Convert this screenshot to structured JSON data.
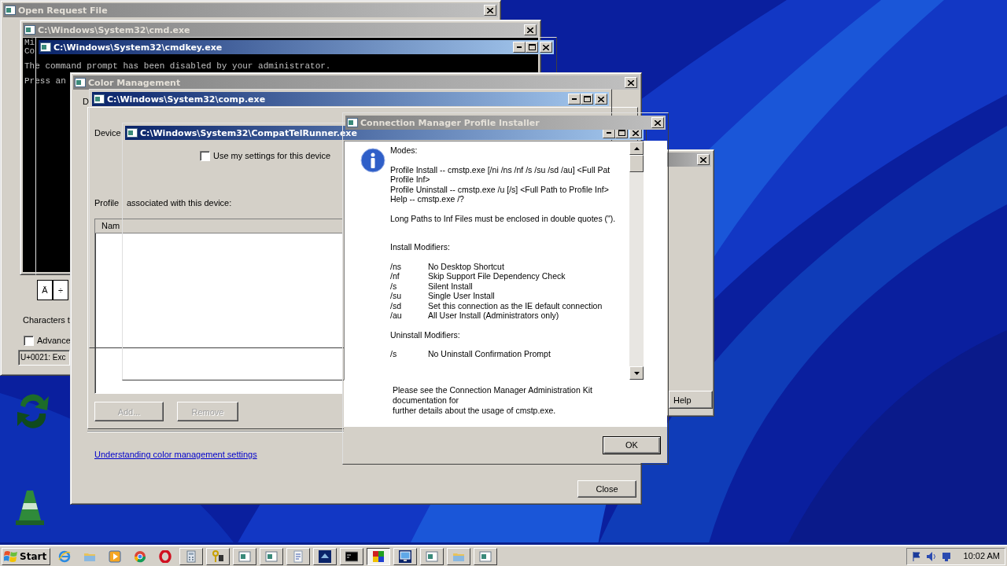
{
  "windows": [
    {
      "kind": "charmap",
      "title": "Open Request File",
      "active": false,
      "can_minimize": false,
      "grid": [
        "Ä",
        "÷"
      ],
      "caption": "Characters t",
      "advanced": {
        "label": "Advance",
        "checked": false
      },
      "code_field": "U+0021: Exc"
    },
    {
      "kind": "console",
      "title": "C:\\Windows\\System32\\cmd.exe",
      "active": false,
      "can_minimize": false,
      "lines": [
        "Mi",
        "Co",
        "The command prompt has been disabled by your administrator.",
        "Press an"
      ]
    },
    {
      "kind": "ghost",
      "title": "C:\\Windows\\System32\\cmdkey.exe",
      "active": true,
      "can_minimize": true
    },
    {
      "kind": "color",
      "title": "Color Management",
      "active": false,
      "can_minimize": false,
      "tab": "D",
      "device_label": "Device",
      "use_my_settings": {
        "label": "Use my settings for this device",
        "checked": false
      },
      "profiles_label": [
        "Profile",
        "associated with this device:"
      ],
      "column": "Nam",
      "buttons": [
        {
          "label": "Add...",
          "disabled": true
        },
        {
          "label": "Remove",
          "disabled": true
        }
      ],
      "link": "Understanding color management settings",
      "close_button": "Close"
    },
    {
      "kind": "ghost",
      "title": "C:\\Windows\\System32\\comp.exe",
      "active": true,
      "can_minimize": true
    },
    {
      "kind": "ghost",
      "title": "C:\\Windows\\System32\\CompatTelRunner.exe",
      "active": true,
      "can_minimize": true
    },
    {
      "kind": "back",
      "active": false,
      "can_minimize": false,
      "help_button": "Help"
    },
    {
      "kind": "message",
      "title": "Connection Manager Profile Installer",
      "active": false,
      "can_minimize": false,
      "paragraphs": [
        {
          "kind": "text",
          "lines": [
            "Modes:"
          ]
        },
        {
          "kind": "text",
          "lines": [
            "Profile Install -- cmstp.exe [/ni /ns /nf /s /su /sd /au] <Full Pat",
            "Profile Inf>",
            "Profile Uninstall -- cmstp.exe /u [/s] <Full Path to Profile Inf>",
            "Help -- cmstp.exe /?"
          ]
        },
        {
          "kind": "text",
          "lines": [
            "Long Paths to Inf Files must be enclosed in double quotes (\")."
          ]
        },
        {
          "kind": "text",
          "lines": [
            "Install Modifiers:"
          ]
        },
        {
          "kind": "options",
          "options": [
            {
              "flag": "/ns",
              "text": "No Desktop Shortcut"
            },
            {
              "flag": "/nf",
              "text": "Skip Support File Dependency Check"
            },
            {
              "flag": "/s",
              "text": "Silent Install"
            },
            {
              "flag": "/su",
              "text": "Single User Install"
            },
            {
              "flag": "/sd",
              "text": "Set this connection as the IE default connection"
            },
            {
              "flag": "/au",
              "text": "All User Install (Administrators only)"
            }
          ]
        },
        {
          "kind": "text",
          "lines": [
            "Uninstall Modifiers:"
          ]
        },
        {
          "kind": "options",
          "options": [
            {
              "flag": "/s",
              "text": "No Uninstall Confirmation Prompt"
            }
          ]
        }
      ],
      "footer_lines": [
        "Please see the Connection Manager Administration Kit",
        "documentation for",
        "further details about the usage of cmstp.exe."
      ],
      "ok_button": "OK"
    }
  ],
  "taskbar": {
    "start_label": "Start",
    "items": [
      {
        "kind": "ie",
        "selected": false
      },
      {
        "kind": "folder",
        "selected": false
      },
      {
        "kind": "media",
        "selected": false
      },
      {
        "kind": "chrome",
        "selected": false
      },
      {
        "kind": "opera",
        "selected": false
      },
      {
        "kind": "calc",
        "selected": false
      },
      {
        "kind": "keys",
        "selected": false
      },
      {
        "kind": "app",
        "selected": false
      },
      {
        "kind": "app",
        "selected": false
      },
      {
        "kind": "doc",
        "selected": false
      },
      {
        "kind": "dark",
        "selected": false
      },
      {
        "kind": "cmd",
        "selected": false
      },
      {
        "kind": "colors",
        "selected": true
      },
      {
        "kind": "monitor",
        "selected": false
      },
      {
        "kind": "app",
        "selected": false
      },
      {
        "kind": "folder",
        "selected": false
      },
      {
        "kind": "app",
        "selected": false
      }
    ],
    "clock": "10:02 AM"
  }
}
